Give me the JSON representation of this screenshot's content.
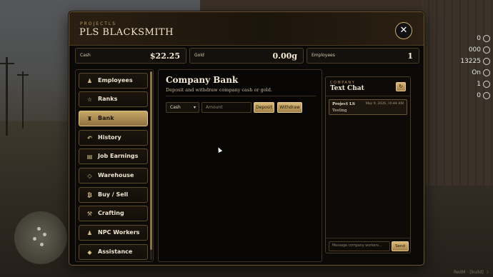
{
  "header": {
    "eyebrow": "PROJECTLS",
    "title": "PLS BLACKSMITH",
    "close_glyph": "✕"
  },
  "stats": [
    {
      "label": "Cash",
      "value": "$22.25"
    },
    {
      "label": "Gold",
      "value": "0.00g"
    },
    {
      "label": "Employees",
      "value": "1"
    }
  ],
  "sidebar": {
    "items": [
      {
        "label": "Employees",
        "icon": "person-icon",
        "glyph": "♟"
      },
      {
        "label": "Ranks",
        "icon": "star-icon",
        "glyph": "☆"
      },
      {
        "label": "Bank",
        "icon": "bank-icon",
        "glyph": "♜",
        "active": true
      },
      {
        "label": "History",
        "icon": "history-icon",
        "glyph": "↶"
      },
      {
        "label": "Job Earnings",
        "icon": "ledger-icon",
        "glyph": "▤"
      },
      {
        "label": "Warehouse",
        "icon": "box-icon",
        "glyph": "◇"
      },
      {
        "label": "Buy / Sell",
        "icon": "bag-icon",
        "glyph": "₿"
      },
      {
        "label": "Crafting",
        "icon": "hammers-icon",
        "glyph": "⚒"
      },
      {
        "label": "NPC Workers",
        "icon": "worker-icon",
        "glyph": "♟"
      },
      {
        "label": "Assistance",
        "icon": "diamond-icon",
        "glyph": "◆"
      }
    ]
  },
  "bank": {
    "title": "Company Bank",
    "subtitle": "Deposit and withdraw company cash or gold.",
    "currency_selected": "Cash",
    "amount_placeholder": "Amount",
    "deposit_label": "Deposit",
    "withdraw_label": "Withdraw"
  },
  "chat": {
    "eyebrow": "COMPANY",
    "title": "Text Chat",
    "refresh_glyph": "↻",
    "messages": [
      {
        "author": "Project LS",
        "time": "May 9, 2026, 10:44 AM",
        "text": "Testing"
      }
    ],
    "input_placeholder": "Message company workers...",
    "send_label": "Send"
  },
  "hud": [
    "0",
    "000",
    "13225",
    "On",
    "1",
    "0"
  ],
  "watermark": "RedM · [build] ☽",
  "colors": {
    "accent_gold": "#c9ab6c",
    "panel_bg": "#0b0907",
    "active_tab": "#c7a766"
  }
}
